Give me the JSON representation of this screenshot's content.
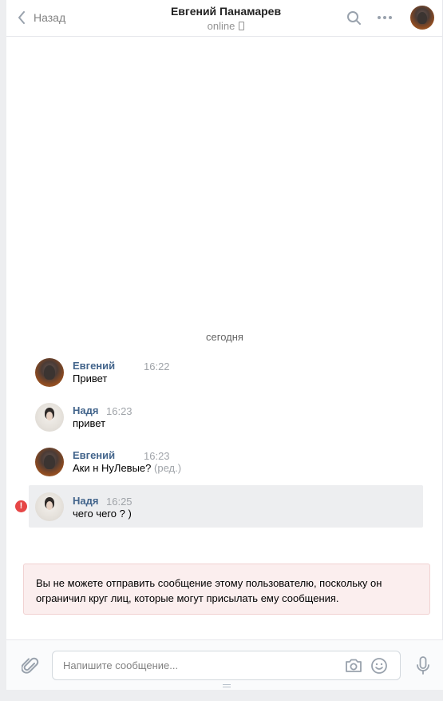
{
  "header": {
    "back_label": "Назад",
    "contact_name": "Евгений Панамарев",
    "status": "online",
    "icons": [
      "chevron-left-icon",
      "search-icon",
      "more-icon",
      "avatar"
    ]
  },
  "chat": {
    "date_separator": "сегодня",
    "messages": [
      {
        "author": "Евгений",
        "time": "16:22",
        "text": "Привет",
        "edited": ""
      },
      {
        "author": "Надя",
        "time": "16:23",
        "text": "привет",
        "edited": ""
      },
      {
        "author": "Евгений",
        "time": "16:23",
        "text": "Аки н НуЛевые?",
        "edited": "(ред.)"
      },
      {
        "author": "Надя",
        "time": "16:25",
        "text": "чего чего ? )",
        "edited": ""
      }
    ],
    "error_mark": "!"
  },
  "notice": {
    "text": "Вы не можете отправить сообщение этому пользователю, поскольку он ограничил круг лиц, которые могут присылать ему сообщения."
  },
  "composer": {
    "placeholder": "Напишите сообщение...",
    "icons": [
      "paperclip-icon",
      "camera-icon",
      "emoji-icon",
      "microphone-icon"
    ]
  },
  "colors": {
    "name_link": "#42648b",
    "error": "#e64646",
    "notice_bg": "#fbeeee"
  }
}
